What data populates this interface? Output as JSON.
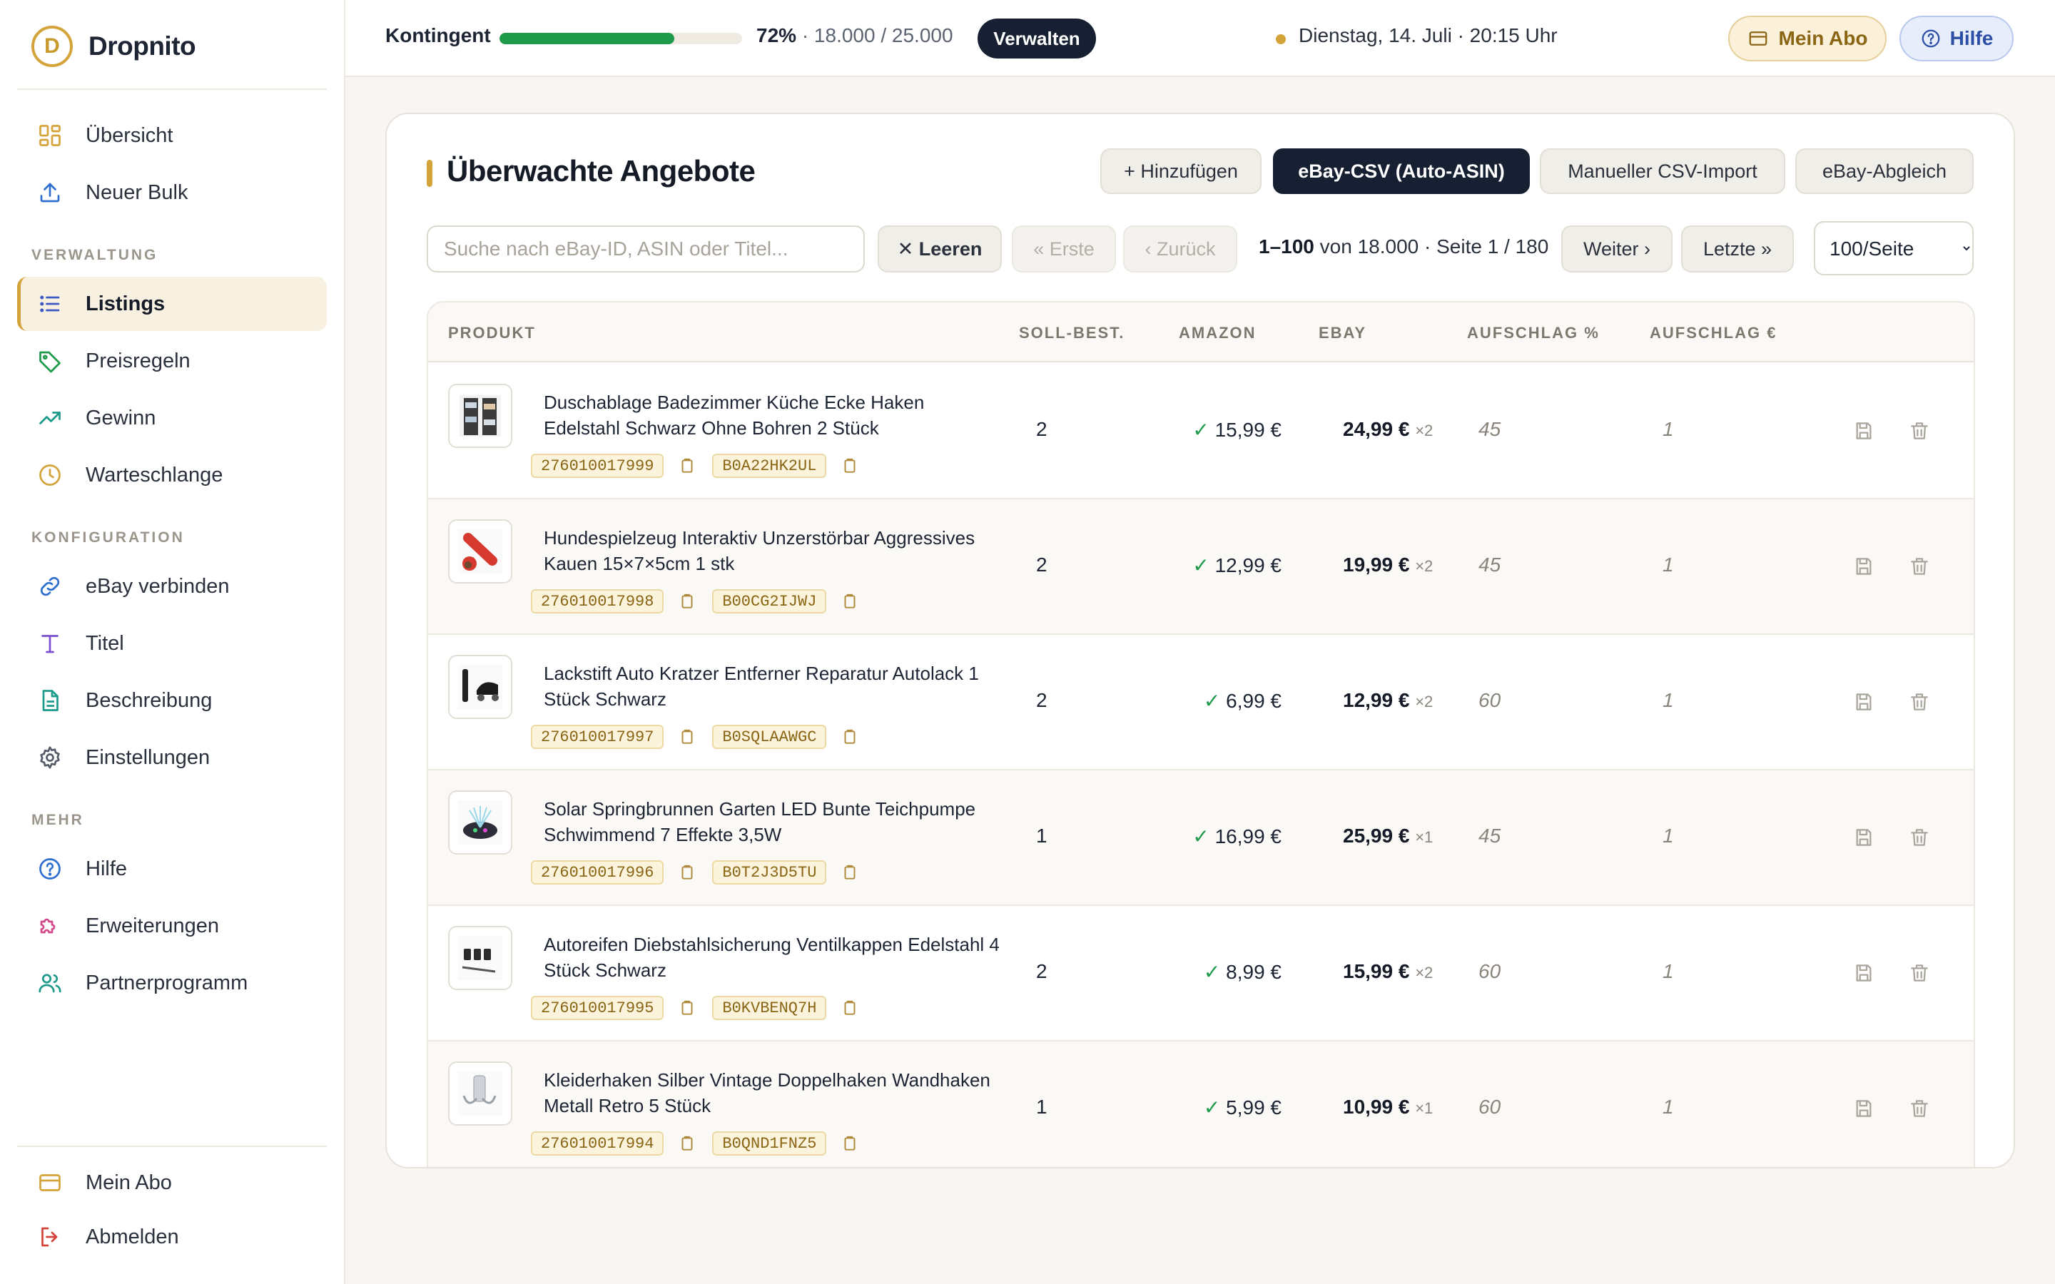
{
  "brand": {
    "name": "Dropnito",
    "logo_letter": "D"
  },
  "sidebar": {
    "top_items": [
      {
        "label": "Übersicht",
        "icon": "grid-icon"
      },
      {
        "label": "Neuer Bulk",
        "icon": "upload-icon"
      }
    ],
    "section_verwaltung": "VERWALTUNG",
    "verwaltung_items": [
      {
        "label": "Listings",
        "icon": "list-icon",
        "active": true
      },
      {
        "label": "Preisregeln",
        "icon": "tag-icon"
      },
      {
        "label": "Gewinn",
        "icon": "trending-up-icon"
      },
      {
        "label": "Warteschlange",
        "icon": "clock-icon"
      }
    ],
    "section_konfiguration": "KONFIGURATION",
    "konfiguration_items": [
      {
        "label": "eBay verbinden",
        "icon": "link-icon"
      },
      {
        "label": "Titel",
        "icon": "text-icon"
      },
      {
        "label": "Beschreibung",
        "icon": "document-icon"
      },
      {
        "label": "Einstellungen",
        "icon": "gear-icon"
      }
    ],
    "section_mehr": "MEHR",
    "mehr_items": [
      {
        "label": "Hilfe",
        "icon": "help-circle-icon"
      },
      {
        "label": "Erweiterungen",
        "icon": "puzzle-icon"
      },
      {
        "label": "Partnerprogramm",
        "icon": "users-icon"
      }
    ],
    "bottom_items": [
      {
        "label": "Mein Abo",
        "icon": "credit-card-icon"
      },
      {
        "label": "Abmelden",
        "icon": "logout-icon"
      }
    ]
  },
  "topbar": {
    "quota_label": "Kontingent",
    "quota_percent": 72,
    "quota_percent_text": "72%",
    "quota_detail": "· 18.000 / 25.000",
    "manage_label": "Verwalten",
    "date_text": "Dienstag, 14. Juli · 20:15 Uhr",
    "abo_label": "Mein Abo",
    "help_label": "Hilfe"
  },
  "colors": {
    "accent": "#d4a43a",
    "primary": "#162032",
    "success": "#1f9a4a",
    "help_blue": "#2c4fa6"
  },
  "main": {
    "title": "Überwachte Angebote",
    "actions": {
      "add": "+ Hinzufügen",
      "ebay_csv": "eBay-CSV (Auto-ASIN)",
      "manual_csv": "Manueller CSV-Import",
      "ebay_sync": "eBay-Abgleich"
    },
    "search_placeholder": "Suche nach eBay-ID, ASIN oder Titel...",
    "clear_label": "✕ Leeren",
    "first_label": "« Erste",
    "prev_label": "‹ Zurück",
    "range_bold": "1–100",
    "range_rest": "von 18.000 · Seite 1 / 180",
    "next_label": "Weiter ›",
    "last_label": "Letzte »",
    "per_page_selected": "100/Seite",
    "columns": {
      "produkt": "PRODUKT",
      "soll": "SOLL-BEST.",
      "amazon": "AMAZON",
      "ebay": "EBAY",
      "aufschlag_pct": "AUFSCHLAG %",
      "aufschlag_eur": "AUFSCHLAG €"
    },
    "rows": [
      {
        "title": "Duschablage Badezimmer Küche Ecke Haken Edelstahl Schwarz Ohne Bohren 2 Stück",
        "ebay_id": "276010017999",
        "asin": "B0A22HK2UL",
        "soll": "2",
        "amazon_price": "15,99 €",
        "ebay_price": "24,99 €",
        "qty": "×2",
        "pct": "45",
        "eur": "1",
        "thumb": "shelf"
      },
      {
        "title": "Hundespielzeug Interaktiv Unzerstörbar Aggressives Kauen 15×7×5cm 1 stk",
        "ebay_id": "276010017998",
        "asin": "B00CG2IJWJ",
        "soll": "2",
        "amazon_price": "12,99 €",
        "ebay_price": "19,99 €",
        "qty": "×2",
        "pct": "45",
        "eur": "1",
        "thumb": "toy"
      },
      {
        "title": "Lackstift Auto Kratzer Entferner Reparatur Autolack 1 Stück Schwarz",
        "ebay_id": "276010017997",
        "asin": "B0SQLAAWGC",
        "soll": "2",
        "amazon_price": "6,99 €",
        "ebay_price": "12,99 €",
        "qty": "×2",
        "pct": "60",
        "eur": "1",
        "thumb": "pen"
      },
      {
        "title": "Solar Springbrunnen Garten LED Bunte Teichpumpe Schwimmend 7 Effekte 3,5W",
        "ebay_id": "276010017996",
        "asin": "B0T2J3D5TU",
        "soll": "1",
        "amazon_price": "16,99 €",
        "ebay_price": "25,99 €",
        "qty": "×1",
        "pct": "45",
        "eur": "1",
        "thumb": "fountain"
      },
      {
        "title": "Autoreifen Diebstahlsicherung Ventilkappen Edelstahl 4 Stück Schwarz",
        "ebay_id": "276010017995",
        "asin": "B0KVBENQ7H",
        "soll": "2",
        "amazon_price": "8,99 €",
        "ebay_price": "15,99 €",
        "qty": "×2",
        "pct": "60",
        "eur": "1",
        "thumb": "caps"
      },
      {
        "title": "Kleiderhaken Silber Vintage Doppelhaken Wandhaken Metall Retro 5 Stück",
        "ebay_id": "276010017994",
        "asin": "B0QND1FNZ5",
        "soll": "1",
        "amazon_price": "5,99 €",
        "ebay_price": "10,99 €",
        "qty": "×1",
        "pct": "60",
        "eur": "1",
        "thumb": "hook"
      }
    ]
  }
}
